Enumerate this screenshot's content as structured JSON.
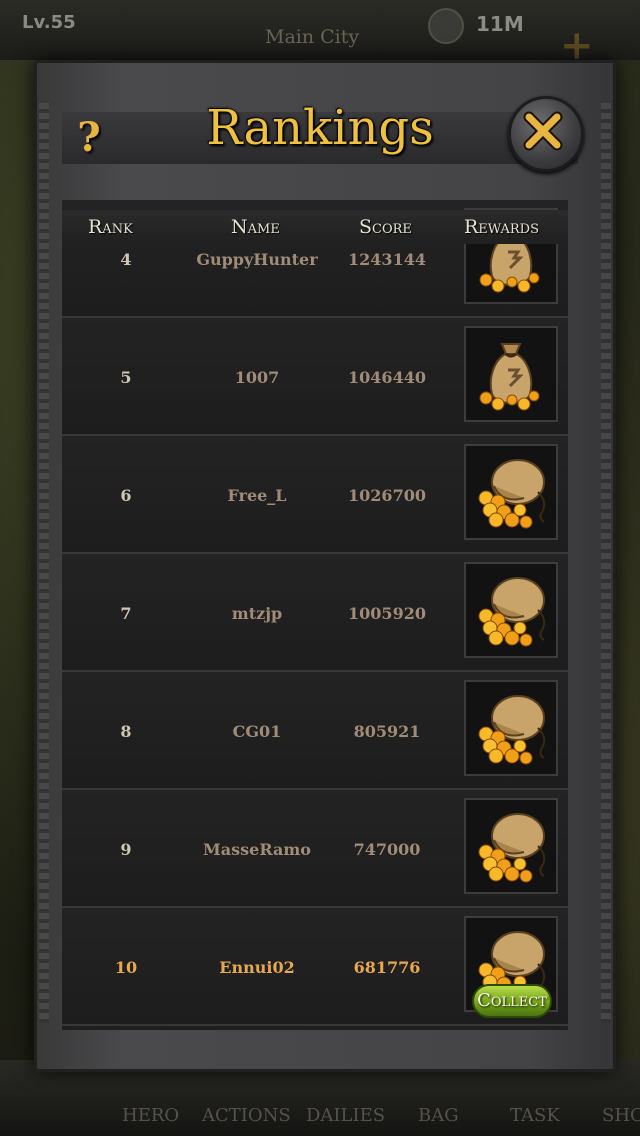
{
  "hud": {
    "level": "Lv.55",
    "location": "Main City",
    "gold": "11M"
  },
  "bottom_nav": [
    "HERO",
    "ACTIONS",
    "DAILIES",
    "BAG",
    "TASK",
    "SHO"
  ],
  "dialog": {
    "title": "Rankings",
    "help_label": "?",
    "columns": {
      "rank": "Rank",
      "name": "Name",
      "score": "Score",
      "rewards": "Rewards"
    },
    "rows": [
      {
        "rank": "4",
        "name": "GuppyHunter",
        "score": "1243144",
        "reward_icon": "small-gold-sack-icon"
      },
      {
        "rank": "5",
        "name": "1007",
        "score": "1046440",
        "reward_icon": "small-gold-sack-icon"
      },
      {
        "rank": "6",
        "name": "Free_L",
        "score": "1026700",
        "reward_icon": "large-gold-sack-icon"
      },
      {
        "rank": "7",
        "name": "mtzjp",
        "score": "1005920",
        "reward_icon": "large-gold-sack-icon"
      },
      {
        "rank": "8",
        "name": "CG01",
        "score": "805921",
        "reward_icon": "large-gold-sack-icon"
      },
      {
        "rank": "9",
        "name": "MasseRamo",
        "score": "747000",
        "reward_icon": "large-gold-sack-icon"
      },
      {
        "rank": "10",
        "name": "Ennui02",
        "score": "681776",
        "reward_icon": "large-gold-sack-icon"
      }
    ],
    "collect_label": "Collect"
  },
  "colors": {
    "title": "#f0c040",
    "highlight_row_text": "#e8a850",
    "row_text": "#a08c78",
    "collect_button": "#8cc02a"
  }
}
